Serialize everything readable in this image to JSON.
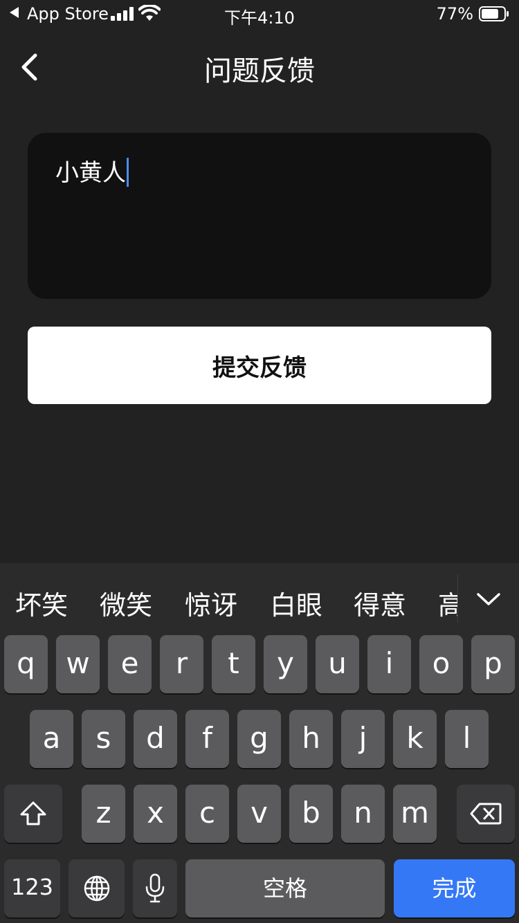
{
  "status_bar": {
    "back_app": "App Store",
    "time": "下午4:10",
    "battery": "77%",
    "battery_level": 0.77
  },
  "nav": {
    "title": "问题反馈",
    "back_icon": "chevron-left-icon"
  },
  "feedback": {
    "text": "小黄人"
  },
  "submit_label": "提交反馈",
  "keyboard": {
    "suggestions": [
      "坏笑",
      "微笑",
      "惊讶",
      "白眼",
      "得意",
      "高"
    ],
    "row1": [
      "q",
      "w",
      "e",
      "r",
      "t",
      "y",
      "u",
      "i",
      "o",
      "p"
    ],
    "row2": [
      "a",
      "s",
      "d",
      "f",
      "g",
      "h",
      "j",
      "k",
      "l"
    ],
    "row3": [
      "z",
      "x",
      "c",
      "v",
      "b",
      "n",
      "m"
    ],
    "numbers": "123",
    "space": "空格",
    "done": "完成",
    "icons": {
      "shift": "shift-icon",
      "delete": "backspace-icon",
      "globe": "globe-icon",
      "mic": "microphone-icon",
      "collapse": "chevron-down-icon"
    },
    "colors": {
      "done_key": "#3478f6",
      "letter_key": "#5b5b5e",
      "function_key": "#3a3a3c"
    }
  }
}
